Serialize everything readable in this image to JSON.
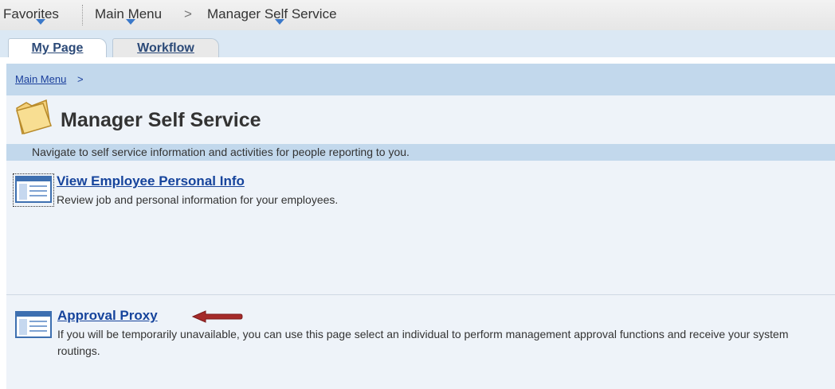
{
  "topnav": {
    "favorites": "Favorites",
    "main_menu": "Main Menu",
    "separator": ">",
    "current": "Manager Self Service"
  },
  "tabs": [
    {
      "label": "My Page",
      "active": true
    },
    {
      "label": "Workflow",
      "active": false
    }
  ],
  "breadcrumb": {
    "link": "Main Menu",
    "gt": ">"
  },
  "page": {
    "title": "Manager Self Service",
    "description": "Navigate to self service information and activities for people reporting to you."
  },
  "items": [
    {
      "title": "View Employee Personal Info",
      "description": "Review job and personal information for your employees.",
      "icon": "page-icon"
    },
    {
      "title": "Approval Proxy",
      "description": "If you will be temporarily unavailable, you can use this page select an individual to perform management approval functions and receive your system routings.",
      "icon": "page-icon"
    }
  ],
  "colors": {
    "link": "#16449c",
    "band": "#c2d8ec",
    "arrow": "#a52a2a"
  }
}
